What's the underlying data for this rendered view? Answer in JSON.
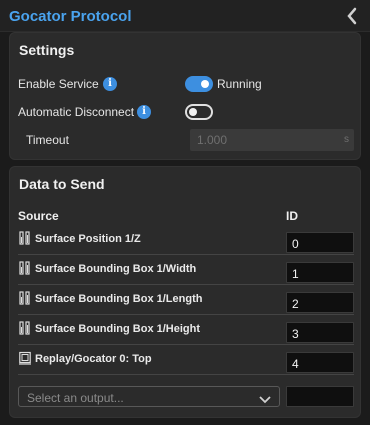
{
  "header": {
    "title": "Gocator Protocol"
  },
  "settings": {
    "title": "Settings",
    "enable_service": {
      "label": "Enable Service",
      "state": "Running",
      "on": true
    },
    "auto_disconnect": {
      "label": "Automatic Disconnect",
      "on": false
    },
    "timeout": {
      "label": "Timeout",
      "value": "1.000",
      "unit": "s"
    }
  },
  "data_to_send": {
    "title": "Data to Send",
    "col_source": "Source",
    "col_id": "ID",
    "rows": [
      {
        "label": "Surface Position 1/Z",
        "id": "0",
        "icon": "measurement-icon"
      },
      {
        "label": "Surface Bounding Box 1/Width",
        "id": "1",
        "icon": "measurement-icon"
      },
      {
        "label": "Surface Bounding Box 1/Length",
        "id": "2",
        "icon": "measurement-icon"
      },
      {
        "label": "Surface Bounding Box 1/Height",
        "id": "3",
        "icon": "measurement-icon"
      },
      {
        "label": "Replay/Gocator 0: Top",
        "id": "4",
        "icon": "image-output-icon"
      }
    ],
    "select_placeholder": "Select an output..."
  },
  "colors": {
    "accent": "#3d8fe0",
    "title": "#4aa3ee",
    "panel": "#2b2b2b",
    "background": "#1b1b1b"
  }
}
